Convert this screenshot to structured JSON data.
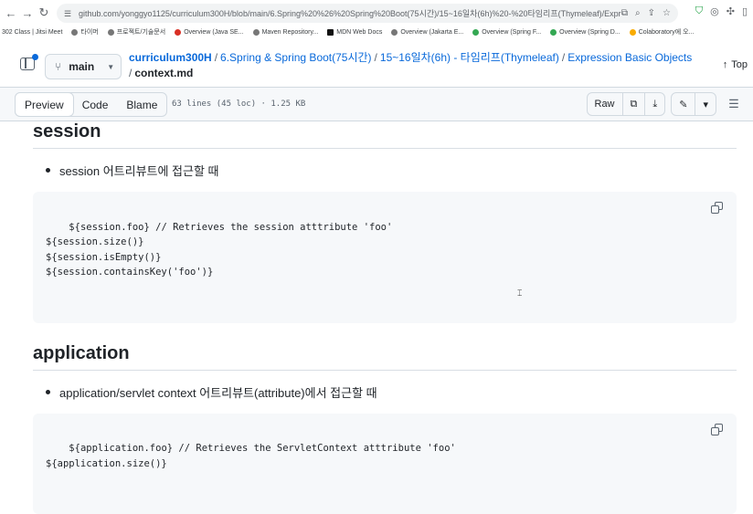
{
  "browser": {
    "url": "github.com/yonggyo1125/curriculum300H/blob/main/6.Spring%20%26%20Spring%20Boot(75시간)/15~16일차(6h)%20-%20타임리프(Thymeleaf)/Expression%20Basic...",
    "bookmarks": [
      "302 Class | Jitsi Meet",
      "타이머",
      "프로젝트/기술문서",
      "Overview (Java SE...",
      "Maven Repository...",
      "MDN Web Docs",
      "Overview (Jakarta E...",
      "Overview (Spring F...",
      "Overview (Spring D...",
      "Colaboratory에 오..."
    ]
  },
  "header": {
    "branch": "main",
    "repo": "curriculum300H",
    "path": [
      "6.Spring & Spring Boot(75시간)",
      "15~16일차(6h) - 타임리프(Thymeleaf)",
      "Expression Basic Objects"
    ],
    "file": "context.md",
    "top_label": "Top"
  },
  "toolbar": {
    "tabs": [
      "Preview",
      "Code",
      "Blame"
    ],
    "active_tab": "Preview",
    "meta": "63 lines (45 loc) · 1.25 KB",
    "raw_label": "Raw"
  },
  "sections": [
    {
      "heading": "session",
      "bullet": "session 어트리뷰트에 접근할 때",
      "code": "${session.foo} // Retrieves the session atttribute 'foo'\n${session.size()}\n${session.isEmpty()}\n${session.containsKey('foo')}"
    },
    {
      "heading": "application",
      "bullet": "application/servlet context 어트리뷰트(attribute)에서 접근할 때",
      "code": "${application.foo} // Retrieves the ServletContext atttribute 'foo'\n${application.size()}"
    }
  ]
}
